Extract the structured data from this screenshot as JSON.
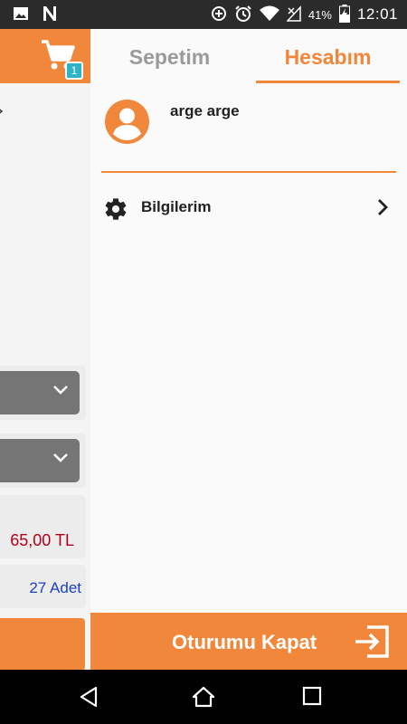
{
  "status_bar": {
    "battery_percent": "41%",
    "time": "12:01",
    "icons": [
      "image-icon",
      "n-icon",
      "data-saver-icon",
      "alarm-icon",
      "wifi-icon",
      "no-signal-icon",
      "battery-charging-icon"
    ]
  },
  "background_app": {
    "cart_badge_count": "1",
    "price_text": "65,00  TL",
    "stock_text": "27 Adet"
  },
  "drawer": {
    "tabs": [
      {
        "label": "Sepetim",
        "active": false
      },
      {
        "label": "Hesabım",
        "active": true
      }
    ],
    "user": {
      "name": "arge arge"
    },
    "menu_items": [
      {
        "label": "Bilgilerim",
        "icon": "gear-icon"
      }
    ],
    "logout_label": "Oturumu Kapat"
  },
  "colors": {
    "accent": "#f0873a",
    "price": "#b3001b",
    "stock": "#1a3fc4",
    "badge": "#2fb3c6"
  }
}
